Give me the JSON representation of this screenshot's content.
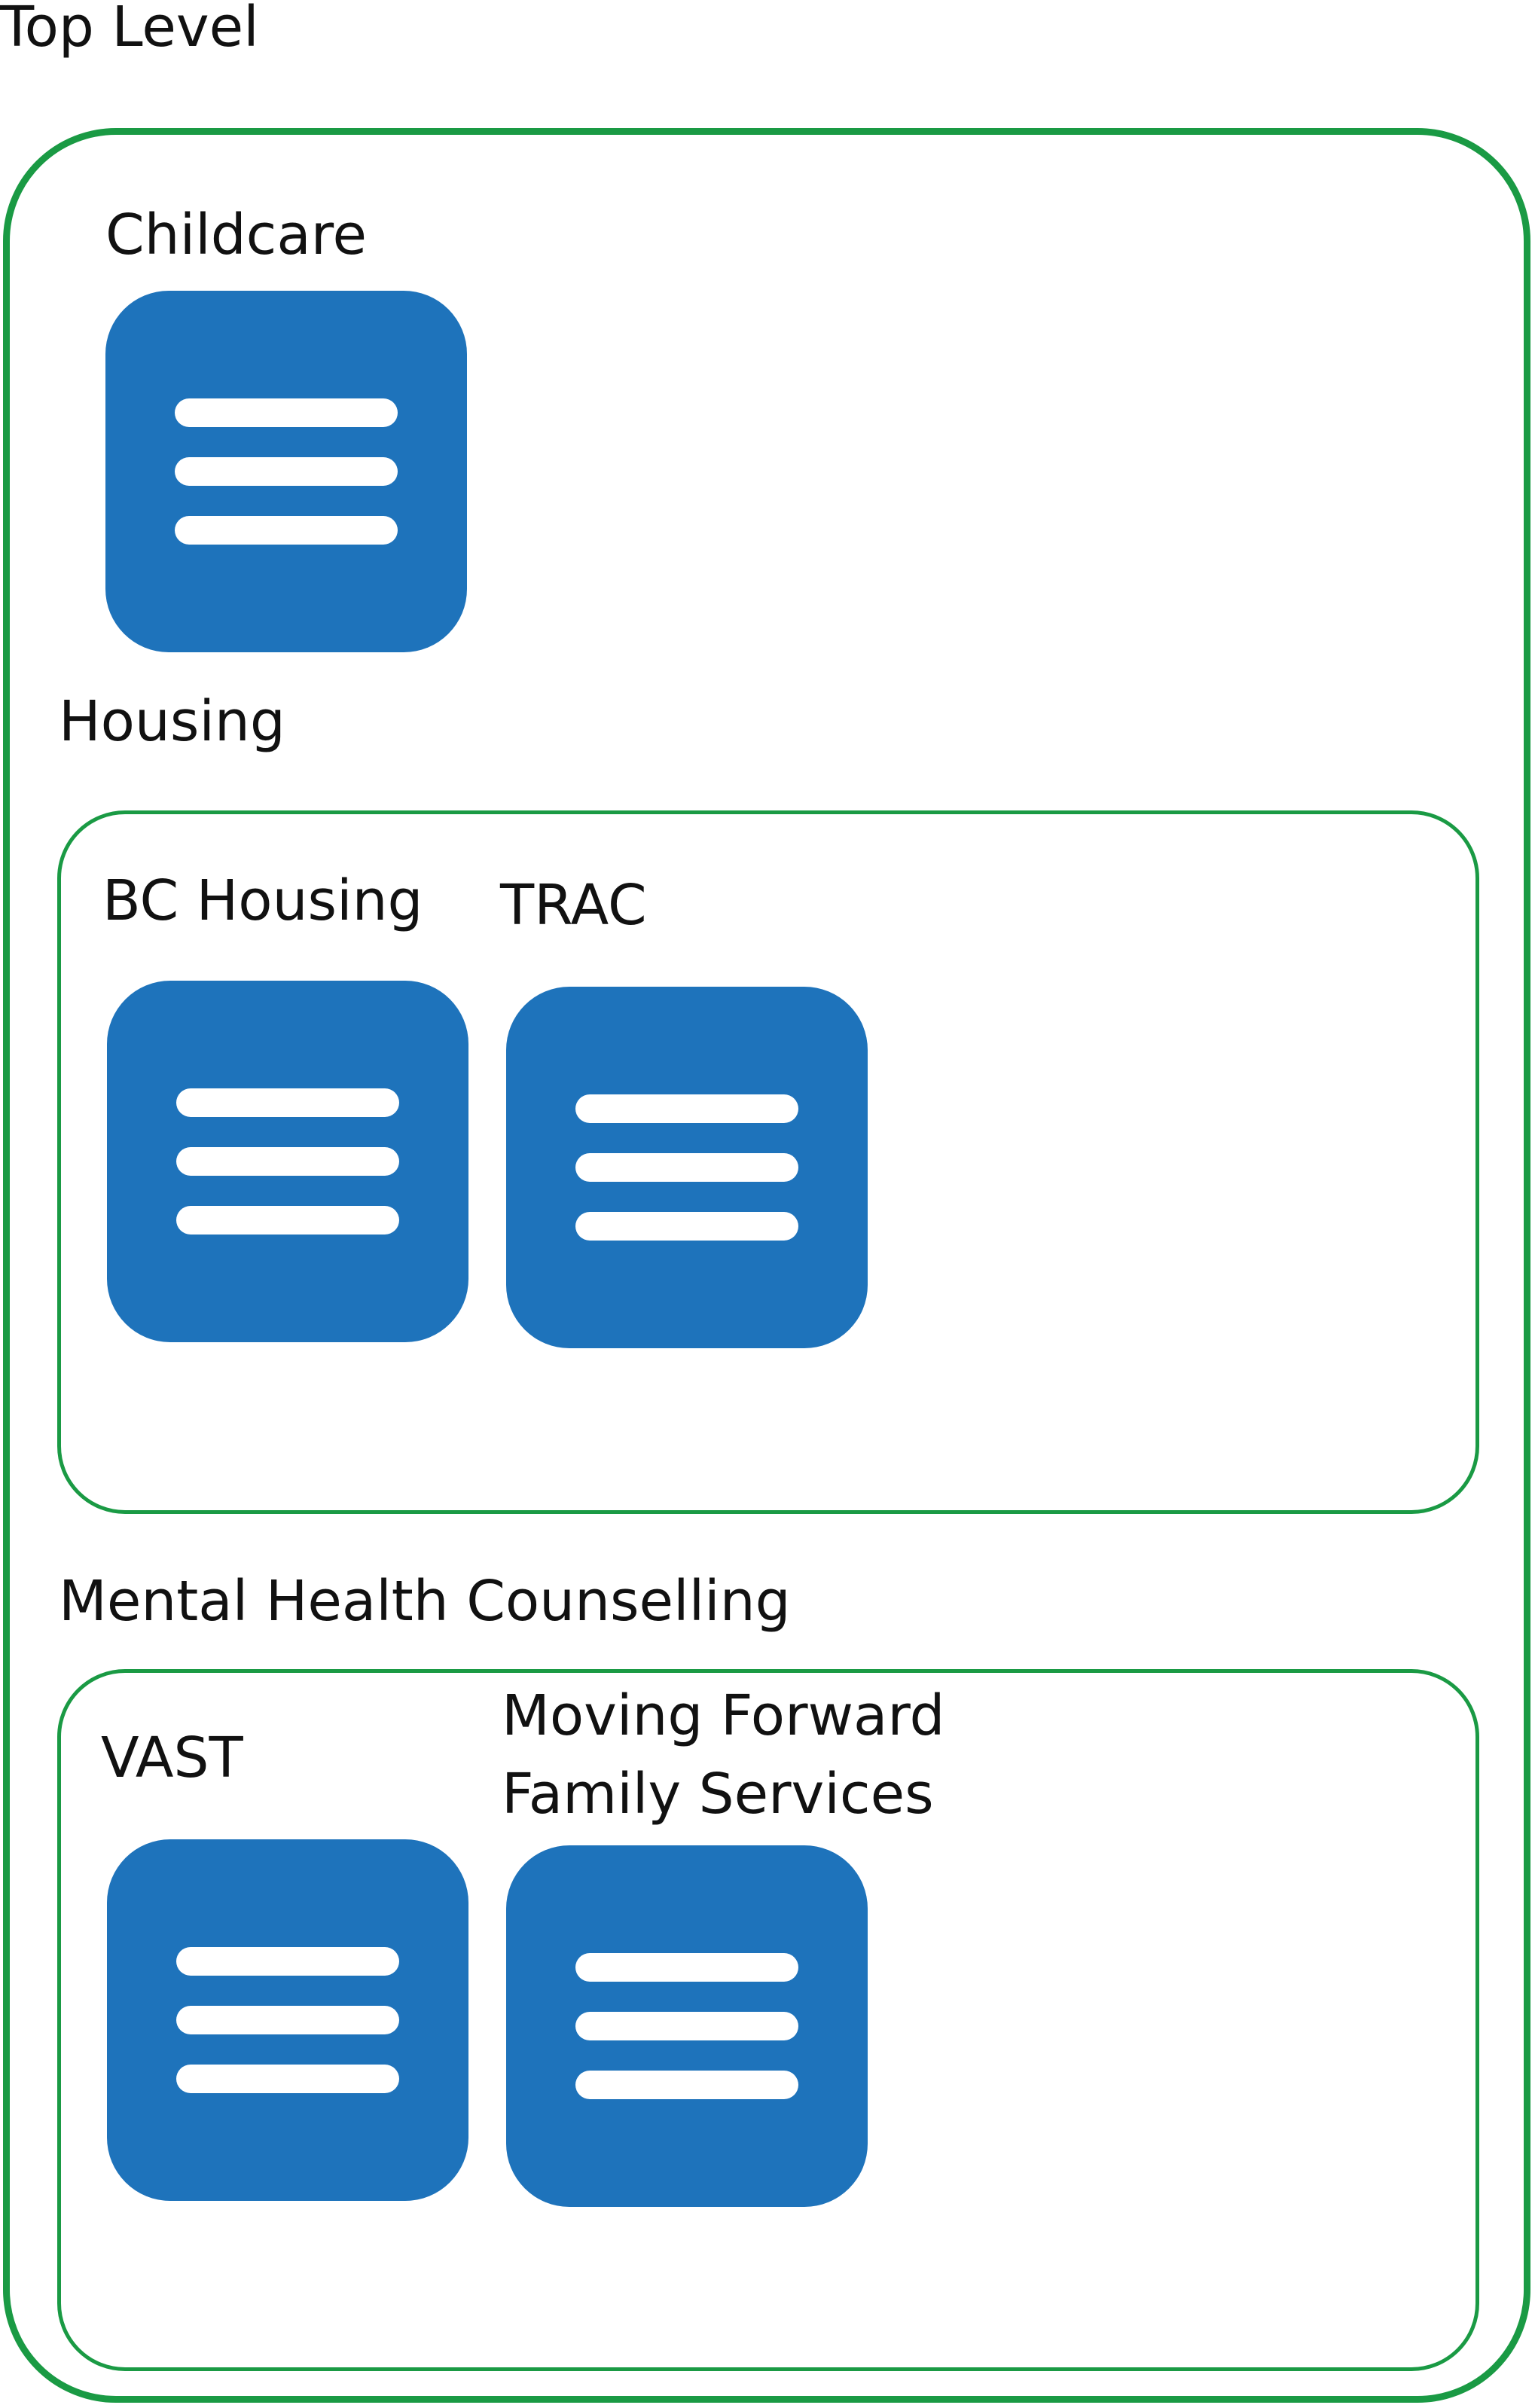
{
  "colors": {
    "group_border": "#1a9a44",
    "tile_fill": "#1e73bb",
    "tile_line": "#ffffff"
  },
  "top_level": {
    "title": "Top Level"
  },
  "childcare": {
    "label": "Childcare",
    "icon": "list-icon"
  },
  "housing": {
    "title": "Housing",
    "items": [
      {
        "label": "BC Housing",
        "icon": "list-icon"
      },
      {
        "label": "TRAC",
        "icon": "list-icon"
      }
    ]
  },
  "mental_health": {
    "title": "Mental Health Counselling",
    "items": [
      {
        "label": "VAST",
        "icon": "list-icon"
      },
      {
        "label_line1": "Moving Forward",
        "label_line2": "Family Services",
        "icon": "list-icon"
      }
    ]
  }
}
